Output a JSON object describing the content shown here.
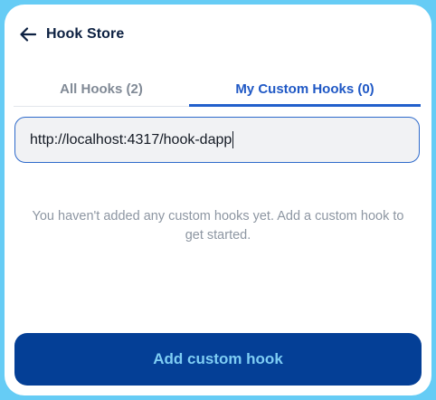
{
  "header": {
    "title": "Hook Store",
    "back_icon": "arrow-left-icon"
  },
  "tabs": [
    {
      "label": "All Hooks (2)",
      "active": false
    },
    {
      "label": "My Custom Hooks (0)",
      "active": true
    }
  ],
  "url_input": {
    "value": "http://localhost:4317/hook-dapp"
  },
  "empty_state": {
    "message": "You haven't added any custom hooks yet. Add a custom hook to get started."
  },
  "add_button": {
    "label": "Add custom hook"
  },
  "colors": {
    "frame_background": "#66ccf5",
    "accent": "#1f58c5",
    "button_background": "#043f96",
    "button_text": "#7ecdf4"
  }
}
